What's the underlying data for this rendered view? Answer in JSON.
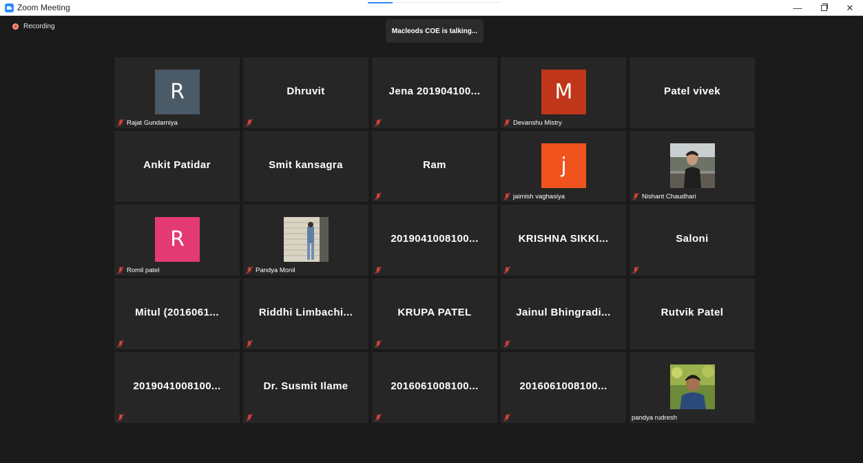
{
  "window": {
    "title": "Zoom Meeting",
    "minimize_glyph": "—",
    "close_glyph": "✕"
  },
  "meeting": {
    "recording_label": "Recording",
    "talking_banner": "Macleods COE is talking..."
  },
  "colors": {
    "tile_bg": "#262626",
    "muted_icon": "#e0453a",
    "accent": "#2d8cff"
  },
  "participants": [
    {
      "display_name": "",
      "avatar_letter": "R",
      "avatar_color": "#4a5a66",
      "label": "Rajat Gundarniya",
      "muted": true
    },
    {
      "display_name": "Dhruvit",
      "label": "",
      "muted": true
    },
    {
      "display_name": "Jena 201904100...",
      "label": "",
      "muted": true
    },
    {
      "display_name": "",
      "avatar_letter": "M",
      "avatar_color": "#c0361a",
      "label": "Devanshu Mistry",
      "muted": true
    },
    {
      "display_name": "Patel vivek",
      "label": "",
      "muted": false
    },
    {
      "display_name": "Ankit Patidar",
      "label": "",
      "muted": false
    },
    {
      "display_name": "Smit kansagra",
      "label": "",
      "muted": false
    },
    {
      "display_name": "Ram",
      "label": "",
      "muted": true
    },
    {
      "display_name": "",
      "avatar_letter": "j",
      "avatar_color": "#f0531e",
      "label": "jaimish vaghasiya",
      "muted": true
    },
    {
      "display_name": "",
      "photo": "man-portrait",
      "label": "Nishant Chaudhari",
      "muted": true
    },
    {
      "display_name": "",
      "avatar_letter": "R",
      "avatar_color": "#e43a74",
      "label": "Romil patel",
      "muted": true
    },
    {
      "display_name": "",
      "photo": "wall-photo",
      "label": "Pandya Monil",
      "muted": true
    },
    {
      "display_name": "2019041008100...",
      "label": "",
      "muted": true
    },
    {
      "display_name": "KRISHNA  SIKKI...",
      "label": "",
      "muted": true
    },
    {
      "display_name": "Saloni",
      "label": "",
      "muted": true
    },
    {
      "display_name": "Mitul  (2016061...",
      "label": "",
      "muted": true
    },
    {
      "display_name": "Riddhi  Limbachi...",
      "label": "",
      "muted": true
    },
    {
      "display_name": "KRUPA PATEL",
      "label": "",
      "muted": true
    },
    {
      "display_name": "Jainul  Bhingradi...",
      "label": "",
      "muted": true
    },
    {
      "display_name": "Rutvik Patel",
      "label": "",
      "muted": false
    },
    {
      "display_name": "2019041008100...",
      "label": "",
      "muted": true
    },
    {
      "display_name": "Dr. Susmit Ilame",
      "label": "",
      "muted": true
    },
    {
      "display_name": "2016061008100...",
      "label": "",
      "muted": true
    },
    {
      "display_name": "2016061008100...",
      "label": "",
      "muted": true
    },
    {
      "display_name": "",
      "photo": "young-man-photo",
      "label": "pandya rudresh",
      "muted": false
    }
  ]
}
